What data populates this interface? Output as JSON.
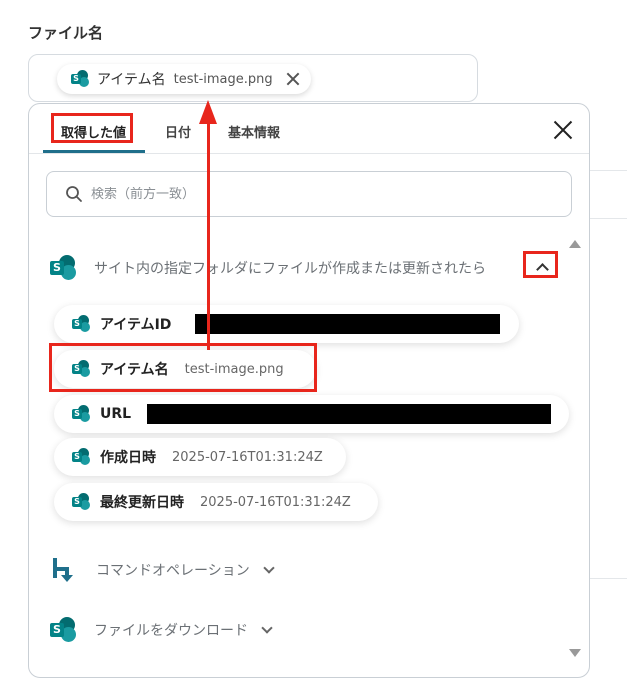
{
  "field": {
    "label": "ファイル名",
    "chip_label": "アイテム名",
    "chip_value": "test-image.png"
  },
  "tabs": [
    {
      "label": "取得した値",
      "active": true
    },
    {
      "label": "日付",
      "active": false
    },
    {
      "label": "基本情報",
      "active": false
    }
  ],
  "search": {
    "placeholder": "検索（前方一致）"
  },
  "sections": [
    {
      "title": "サイト内の指定フォルダにファイルが作成または更新されたら",
      "icon": "sharepoint-icon",
      "expanded": true,
      "items": [
        {
          "label": "アイテムID",
          "value": ""
        },
        {
          "label": "アイテム名",
          "value": "test-image.png"
        },
        {
          "label": "URL",
          "value": ""
        },
        {
          "label": "作成日時",
          "value": "2025-07-16T01:31:24Z"
        },
        {
          "label": "最終更新日時",
          "value": "2025-07-16T01:31:24Z"
        }
      ]
    },
    {
      "title": "コマンドオペレーション",
      "icon": "command-operation-icon",
      "expanded": false
    },
    {
      "title": "ファイルをダウンロード",
      "icon": "sharepoint-icon",
      "expanded": false
    }
  ],
  "colors": {
    "accent": "#1f6f8b",
    "annotation": "#e8261c",
    "sharepoint_dark": "#036c70",
    "sharepoint_light": "#1a9ba1"
  }
}
